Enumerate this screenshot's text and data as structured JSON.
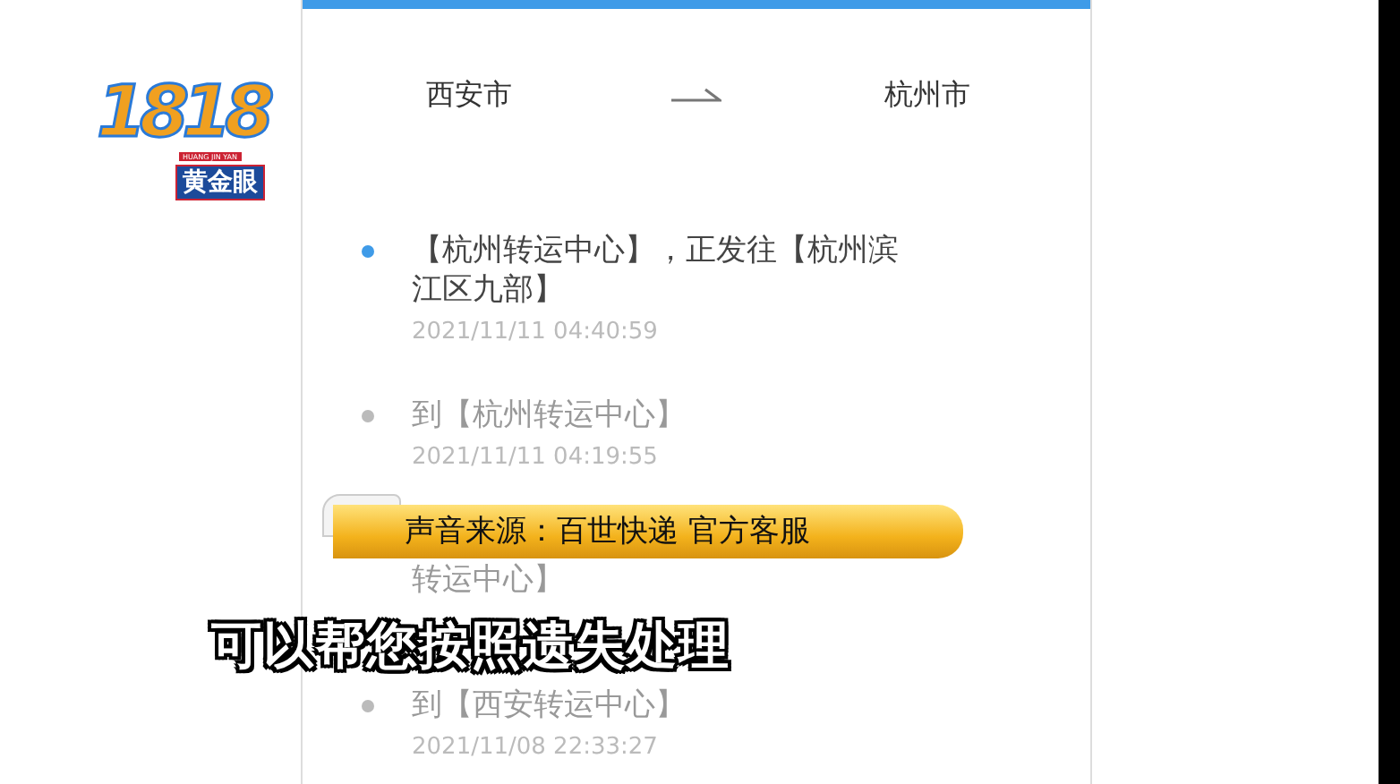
{
  "route": {
    "from": "西安市",
    "to": "杭州市"
  },
  "tracking": [
    {
      "kind": "event",
      "current": true,
      "text": "【杭州转运中心】，正发往【杭州滨江区九部】",
      "time": "2021/11/11 04:40:59"
    },
    {
      "kind": "event",
      "current": false,
      "text": "到【杭州转运中心】",
      "time": "2021/11/11 04:19:55"
    },
    {
      "kind": "covered",
      "text": "转运中心】"
    },
    {
      "kind": "event",
      "current": false,
      "text": "到【西安转运中心】",
      "time": "2021/11/08 22:33:27"
    }
  ],
  "broadcast": {
    "logo": {
      "number": "1818",
      "name": "黄金眼",
      "caption": "HUANG JIN YAN"
    },
    "source_banner": "声音来源：百世快递 官方客服",
    "subtitle": "可以帮您按照遗失处理"
  }
}
